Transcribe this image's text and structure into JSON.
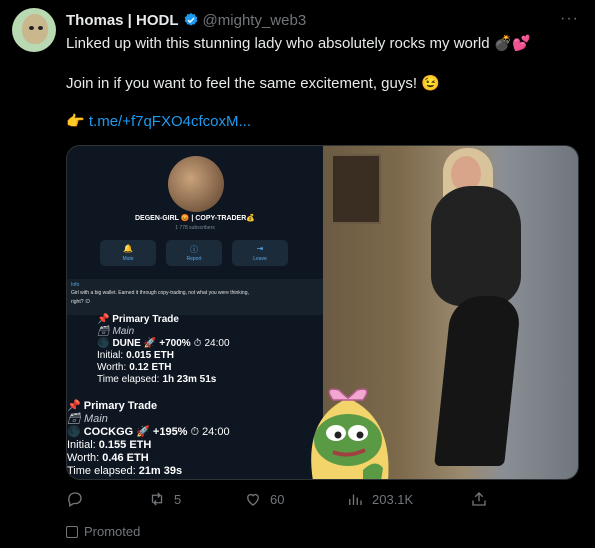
{
  "tweet": {
    "display_name": "Thomas | HODL",
    "handle": "@mighty_web3",
    "line1": "Linked up with this stunning lady who absolutely rocks my world 💣💕",
    "line2": "Join in if you want to feel the same excitement, guys! 😉",
    "link_emoji": "👉",
    "link_text": "t.me/+f7qFXO4cfcoxM..."
  },
  "telegram": {
    "channel_title": "DEGEN-GIRL 😡 | COPY-TRADER💰",
    "subscribers": "1 778 subscribers",
    "buttons": [
      "Mute",
      "Report",
      "Leave"
    ],
    "info_label": "Info",
    "info_text_1": "Girl with a big wallet. Earned it through copy-trading, not what you were thinking,",
    "info_text_2": "right? :D"
  },
  "trade1": {
    "title": "📌 Primary Trade",
    "subtitle": "🗃 Main",
    "coin": "DUNE",
    "gain": "+700%",
    "time": "24:00",
    "initial_label": "Initial:",
    "initial_value": "0.015 ETH",
    "worth_label": "Worth:",
    "worth_value": "0.12 ETH",
    "elapsed_label": "Time elapsed:",
    "elapsed_value": "1h 23m 51s"
  },
  "trade2": {
    "title": "📌 Primary Trade",
    "subtitle": "🗃 Main",
    "coin": "COCKGG",
    "gain": "+195%",
    "time": "24:00",
    "initial_label": "Initial:",
    "initial_value": "0.155 ETH",
    "worth_label": "Worth:",
    "worth_value": "0.46 ETH",
    "elapsed_label": "Time elapsed:",
    "elapsed_value": "21m 39s"
  },
  "actions": {
    "reply_count": "",
    "retweet_count": "5",
    "like_count": "60",
    "views_count": "203.1K"
  },
  "promoted_label": "Promoted",
  "colors": {
    "background": "#000000",
    "text": "#e7e9ea",
    "muted": "#71767b",
    "link": "#1d9bf0",
    "verified": "#1d9bf0"
  }
}
